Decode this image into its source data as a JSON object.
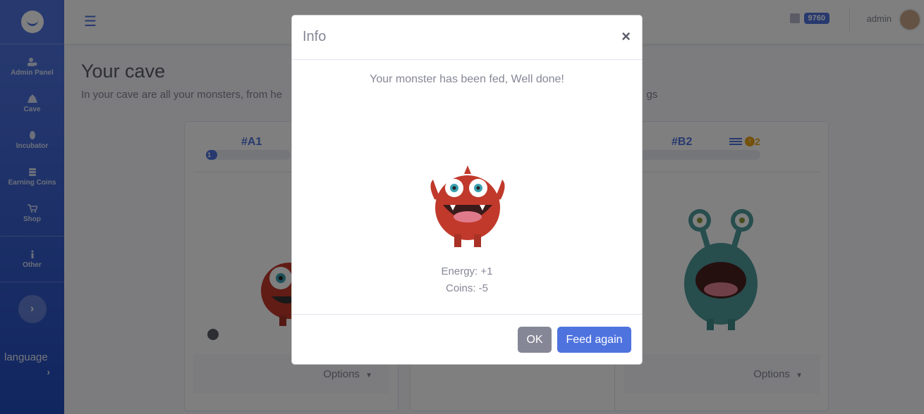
{
  "sidebar": {
    "items": [
      {
        "label": "Admin Panel",
        "icon": "users-cog-icon"
      },
      {
        "label": "Cave",
        "icon": "cave-icon"
      },
      {
        "label": "Incubator",
        "icon": "egg-icon"
      },
      {
        "label": "Earning Coins",
        "icon": "coins-icon"
      },
      {
        "label": "Shop",
        "icon": "cart-icon"
      },
      {
        "label": "Other",
        "icon": "info-icon"
      }
    ],
    "toggle_glyph": "›",
    "language_label": "language",
    "language_chevron": "›"
  },
  "topbar": {
    "menu_glyph": "☰",
    "coins_value": "9760",
    "user_name": "admin"
  },
  "page": {
    "title": "Your cave",
    "subtitle_left": "In your cave are all your monsters, from he",
    "subtitle_right": "gs"
  },
  "cards": [
    {
      "id": "#A1",
      "bar_label": "1",
      "options_label": "Options"
    },
    {
      "id": "#B2",
      "options_label": "Options",
      "level_badge": "2"
    }
  ],
  "modal": {
    "title": "Info",
    "close_glyph": "×",
    "message": "Your monster has been fed, Well done!",
    "energy": "Energy: +1",
    "coins": "Coins: -5",
    "ok_label": "OK",
    "feed_again_label": "Feed again"
  },
  "colors": {
    "primary": "#4e73df",
    "secondary": "#858796",
    "monster_red": "#c0392b",
    "monster_teal": "#4e9a9a"
  }
}
